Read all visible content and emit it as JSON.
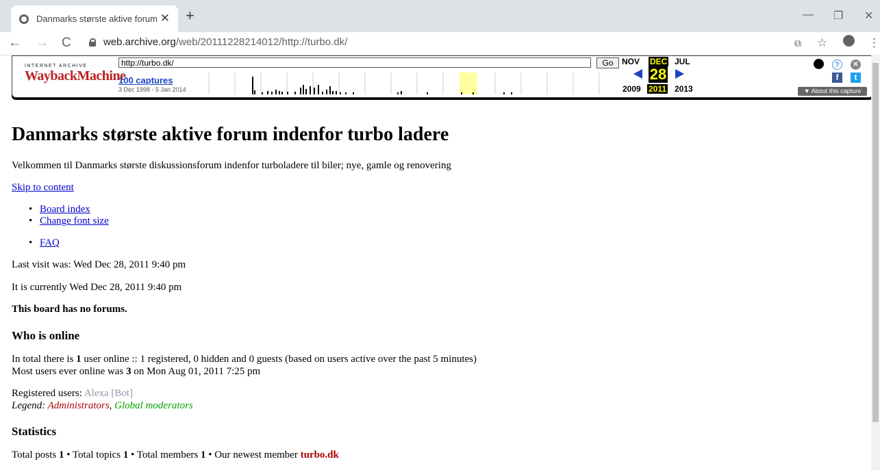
{
  "browser": {
    "tab_title": "Danmarks største aktive forum in",
    "tab_close": "✕",
    "new_tab": "+",
    "url_host": "web.archive.org",
    "url_path": "/web/20111228214012/http://turbo.dk/",
    "back": "←",
    "forward": "→",
    "reload": "C",
    "minimize": "—",
    "restore": "❐",
    "close": "✕",
    "translate": "⧉",
    "star": "☆",
    "menu": "⋮"
  },
  "wayback": {
    "logo_top": "INTERNET ARCHIVE",
    "logo": "WaybackMachine",
    "url_value": "http://turbo.dk/",
    "go_label": "Go",
    "captures": "100 captures",
    "range": "3 Dec 1998 - 5 Jan 2014",
    "prev_month": "NOV",
    "cur_month": "DEC",
    "next_month": "JUL",
    "day": "28",
    "prev_year": "2009",
    "cur_year": "2011",
    "next_year": "2013",
    "about": "▼ About this capture",
    "facebook": "f",
    "twitter": "t",
    "help": "?",
    "close": "✕",
    "account": "●"
  },
  "page": {
    "title": "Danmarks største aktive forum indenfor turbo ladere",
    "description": "Velkommen til Danmarks største diskussionsforum indenfor turboladere til biler; nye, gamle og renovering",
    "skip_link": "Skip to content",
    "nav": [
      "Board index",
      "Change font size",
      "FAQ"
    ],
    "last_visit": "Last visit was: Wed Dec 28, 2011 9:40 pm",
    "current_time": "It is currently Wed Dec 28, 2011 9:40 pm",
    "no_forums": "This board has no forums.",
    "who_online_heading": "Who is online",
    "online_line1_pre": "In total there is ",
    "online_count": "1",
    "online_line1_post": " user online :: 1 registered, 0 hidden and 0 guests (based on users active over the past 5 minutes)",
    "most_users_pre": "Most users ever online was ",
    "most_users_count": "3",
    "most_users_post": " on Mon Aug 01, 2011 7:25 pm",
    "registered_label": "Registered users: ",
    "registered_user": "Alexa [Bot]",
    "legend_label": "Legend: ",
    "legend_admins": "Administrators",
    "legend_sep": ", ",
    "legend_gmods": "Global moderators",
    "statistics_heading": "Statistics",
    "stats_posts_label": "Total posts ",
    "stats_posts": "1",
    "stats_topics_label": " • Total topics ",
    "stats_topics": "1",
    "stats_members_label": " • Total members ",
    "stats_members": "1",
    "stats_newest_label": " • Our newest member ",
    "stats_newest": "turbo.dk"
  },
  "colors": {
    "admin": "#aa0000",
    "gmod": "#00a000",
    "bot": "#9e8da7",
    "link": "#0000cc"
  }
}
